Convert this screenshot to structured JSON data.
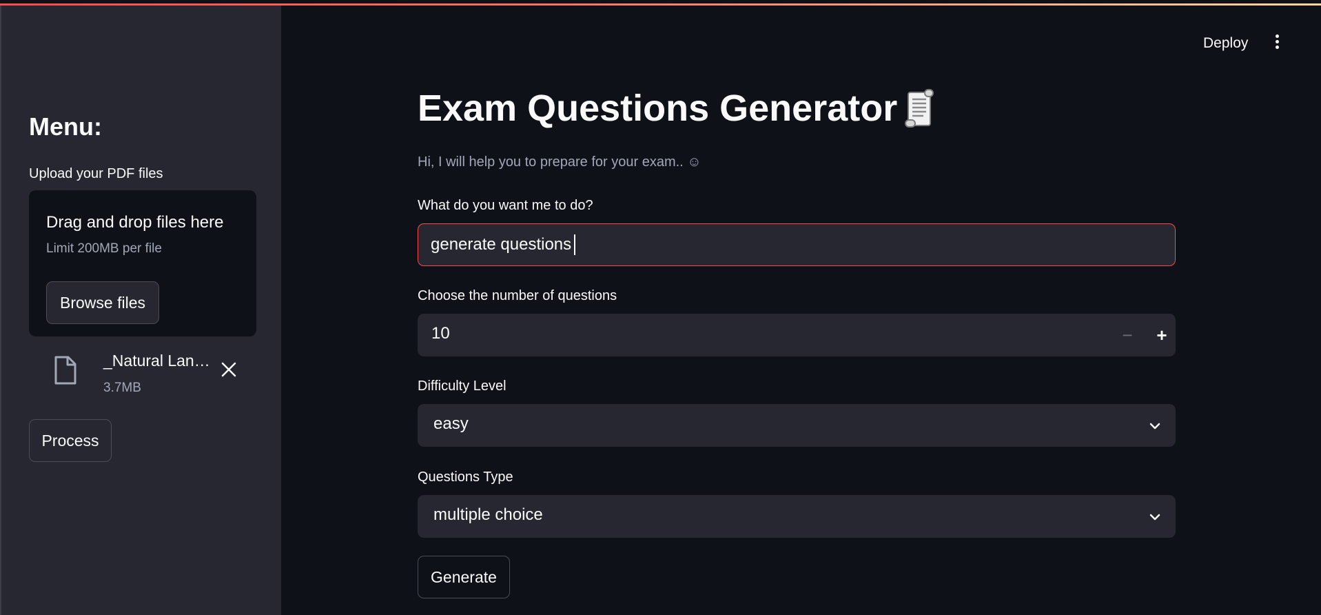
{
  "sidebar": {
    "title": "Menu:",
    "upload_label": "Upload your PDF files",
    "dropzone": {
      "title": "Drag and drop files here",
      "limit": "Limit 200MB per file",
      "browse_label": "Browse files"
    },
    "file": {
      "name": "_Natural Lan…",
      "size": "3.7MB"
    },
    "process_label": "Process"
  },
  "header": {
    "deploy_label": "Deploy"
  },
  "main": {
    "title": "Exam Questions Generator",
    "subtitle": "Hi, I will help you to prepare for your exam.. ☺",
    "task": {
      "label": "What do you want me to do?",
      "value": "generate questions"
    },
    "num_questions": {
      "label": "Choose the number of questions",
      "value": "10",
      "minus": "−",
      "plus": "+"
    },
    "difficulty": {
      "label": "Difficulty Level",
      "value": "easy"
    },
    "questions_type": {
      "label": "Questions Type",
      "value": "multiple choice"
    },
    "generate_label": "Generate"
  },
  "colors": {
    "background": "#0e1117",
    "sidebar": "#262730",
    "accent": "#ff4b4b",
    "muted_text": "#a3a8b8"
  }
}
